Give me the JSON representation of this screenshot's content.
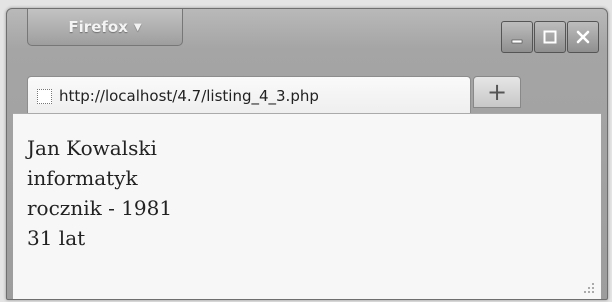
{
  "app": {
    "menu_label": "Firefox",
    "menu_arrow": "▼"
  },
  "tab": {
    "title": "http://localhost/4.7/listing_4_3.php",
    "new_tab_label": "+"
  },
  "page": {
    "lines": [
      "Jan Kowalski",
      "informatyk",
      "rocznik - 1981",
      "31 lat"
    ]
  }
}
